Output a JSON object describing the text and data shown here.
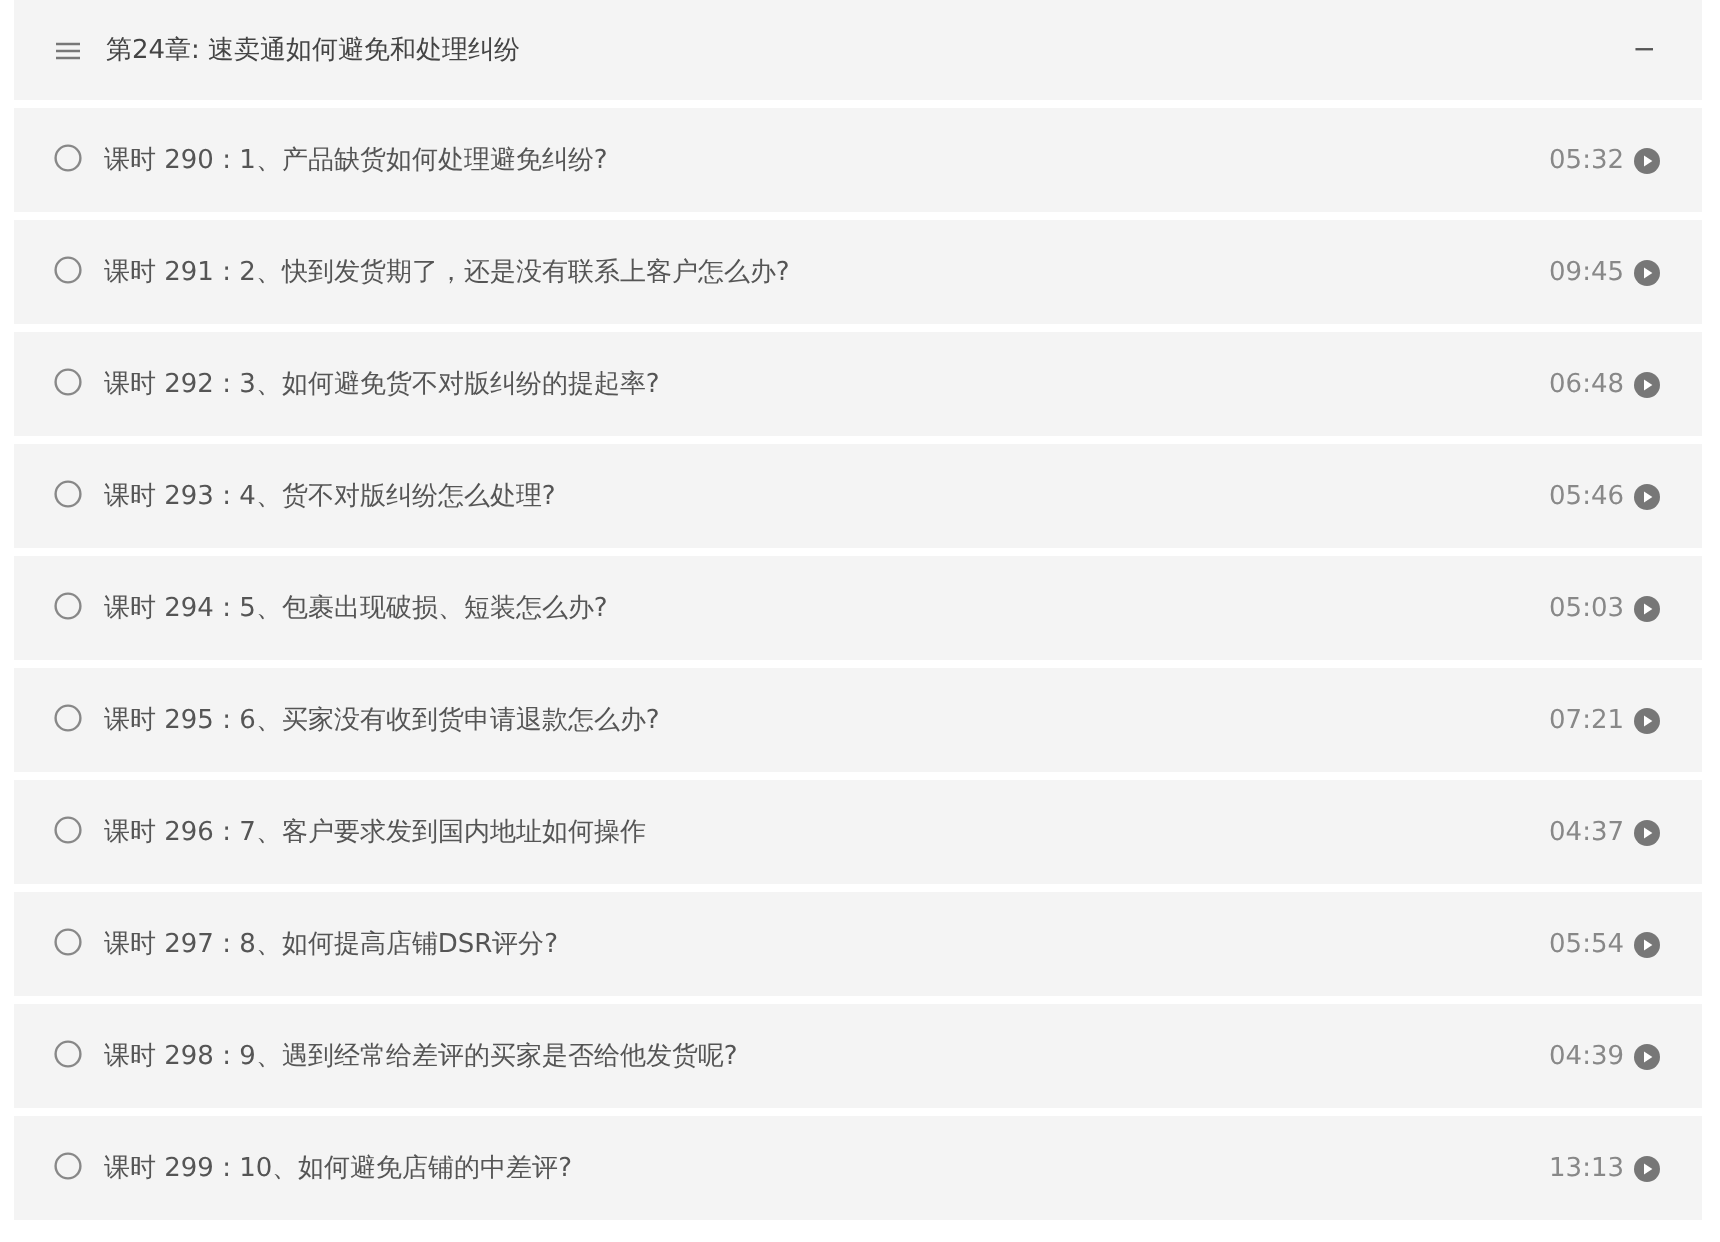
{
  "chapter": {
    "title": "第24章: 速卖通如何避免和处理纠纷",
    "collapse_glyph": "−"
  },
  "lessons": [
    {
      "label": "课时 290 : 1、产品缺货如何处理避免纠纷?",
      "duration": "05:32"
    },
    {
      "label": "课时 291 : 2、快到发货期了，还是没有联系上客户怎么办?",
      "duration": "09:45"
    },
    {
      "label": "课时 292 : 3、如何避免货不对版纠纷的提起率?",
      "duration": "06:48"
    },
    {
      "label": "课时 293 : 4、货不对版纠纷怎么处理?",
      "duration": "05:46"
    },
    {
      "label": "课时 294 : 5、包裹出现破损、短装怎么办?",
      "duration": "05:03"
    },
    {
      "label": "课时 295 : 6、买家没有收到货申请退款怎么办?",
      "duration": "07:21"
    },
    {
      "label": "课时 296 : 7、客户要求发到国内地址如何操作",
      "duration": "04:37"
    },
    {
      "label": "课时 297 : 8、如何提高店铺DSR评分?",
      "duration": "05:54"
    },
    {
      "label": "课时 298 : 9、遇到经常给差评的买家是否给他发货呢?",
      "duration": "04:39"
    },
    {
      "label": "课时 299 : 10、如何避免店铺的中差评?",
      "duration": "13:13"
    }
  ]
}
